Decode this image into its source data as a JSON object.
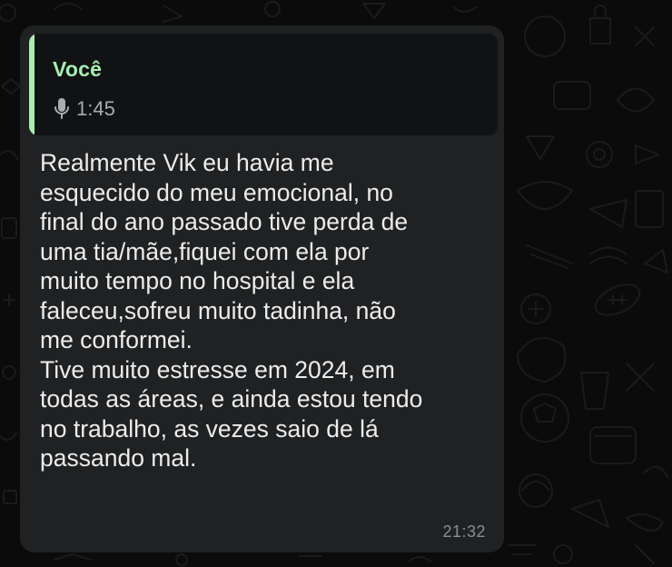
{
  "chat": {
    "message": {
      "quoted": {
        "author": "Você",
        "icon": "microphone-icon",
        "duration": "1:45",
        "accent_color": "#a7eeb0"
      },
      "text": "Realmente Vik eu havia me\nesquecido do meu emocional, no\nfinal do ano passado tive perda de\numa tia/mãe,fiquei com ela por\nmuito tempo no hospital e ela\nfaleceu,sofreu muito tadinha, não\nme conformei.\nTive muito estresse em 2024, em\ntodas as áreas, e ainda estou tendo\nno trabalho, as vezes saio de lá\npassando mal.",
      "time": "21:32"
    }
  },
  "colors": {
    "background": "#0b0b0b",
    "bubble": "#1f2123",
    "quote_background": "#111213",
    "text": "#ececec",
    "time": "#8a8d90"
  }
}
